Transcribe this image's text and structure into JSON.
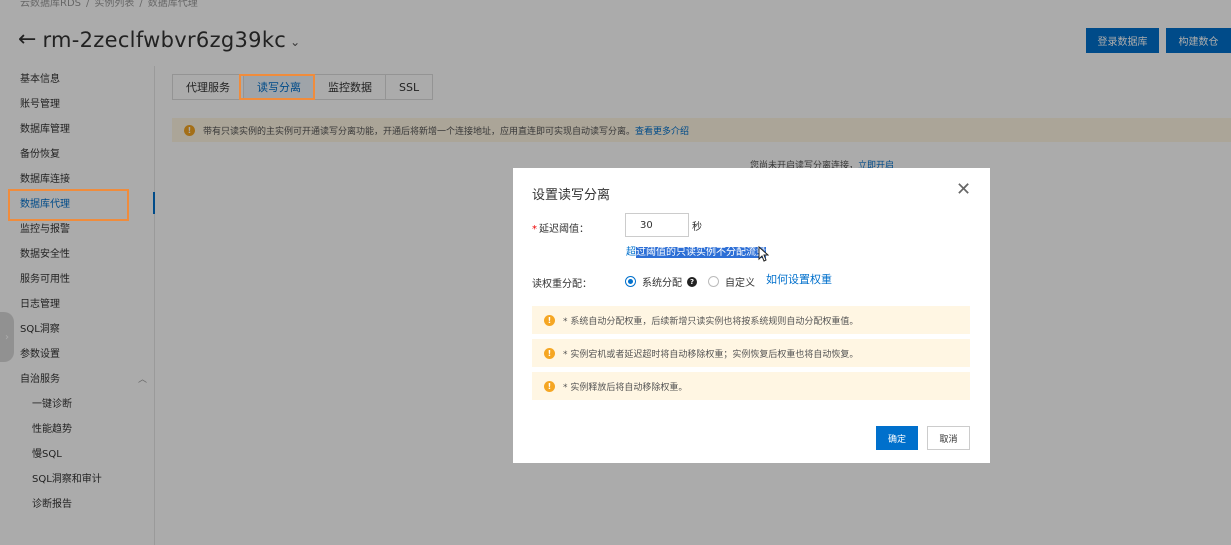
{
  "breadcrumb": [
    "云数据库RDS",
    "实例列表",
    "数据库代理"
  ],
  "header": {
    "back_icon": "arrow-left-icon",
    "instance_id": "rm-2zeclfwbvr6zg39kc",
    "login_button": "登录数据库",
    "build_button": "构建数仓"
  },
  "sidebar": {
    "items": [
      "基本信息",
      "账号管理",
      "数据库管理",
      "备份恢复",
      "数据库连接",
      "数据库代理",
      "监控与报警",
      "数据安全性",
      "服务可用性",
      "日志管理",
      "SQL洞察",
      "参数设置",
      "自治服务"
    ],
    "sub_items": [
      "一键诊断",
      "性能趋势",
      "慢SQL",
      "SQL洞察和审计",
      "诊断报告"
    ],
    "active": "数据库代理"
  },
  "tabs": [
    "代理服务",
    "读写分离",
    "监控数据",
    "SSL"
  ],
  "active_tab": "读写分离",
  "notice": {
    "text": "带有只读实例的主实例可开通读写分离功能，开通后将新增一个连接地址，应用直连即可实现自动读写分离。",
    "link": "查看更多介绍"
  },
  "background_hint": {
    "text": "您尚未开启读写分离连接，",
    "link": "立即开启"
  },
  "dialog": {
    "title": "设置读写分离",
    "delay_label": "延迟阈值：",
    "delay_value": "30",
    "delay_unit": "秒",
    "delay_hint_prefix": "超",
    "delay_hint_selected": "过阈值的只读实例不分配流量",
    "weight_label": "读权重分配：",
    "radio_system": "系统分配",
    "radio_custom": "自定义",
    "weight_link": "如何设置权重",
    "warnings": [
      "* 系统自动分配权重，后续新增只读实例也将按系统规则自动分配权重值。",
      "* 实例宕机或者延迟超时将自动移除权重；实例恢复后权重也将自动恢复。",
      "* 实例释放后将自动移除权重。"
    ],
    "ok_button": "确定",
    "cancel_button": "取消"
  },
  "colors": {
    "primary": "#0070cc",
    "highlight": "#f08c3c",
    "warning_bg": "#fff6e3",
    "warning_icon": "#f5a623"
  }
}
